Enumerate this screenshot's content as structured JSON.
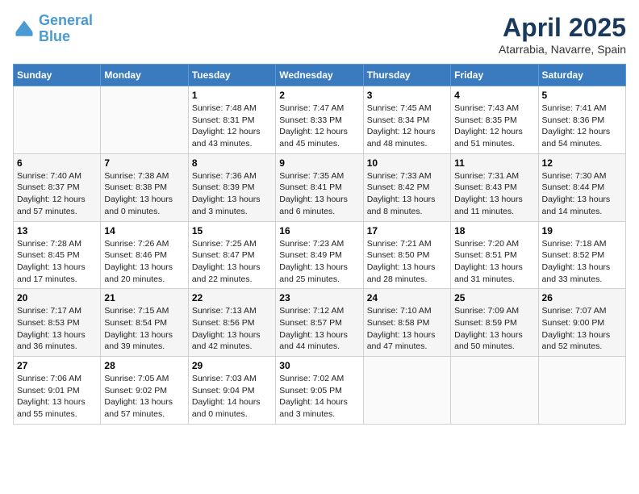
{
  "header": {
    "logo_general": "General",
    "logo_blue": "Blue",
    "month_title": "April 2025",
    "location": "Atarrabia, Navarre, Spain"
  },
  "weekdays": [
    "Sunday",
    "Monday",
    "Tuesday",
    "Wednesday",
    "Thursday",
    "Friday",
    "Saturday"
  ],
  "weeks": [
    [
      {
        "day": "",
        "sunrise": "",
        "sunset": "",
        "daylight": ""
      },
      {
        "day": "",
        "sunrise": "",
        "sunset": "",
        "daylight": ""
      },
      {
        "day": "1",
        "sunrise": "Sunrise: 7:48 AM",
        "sunset": "Sunset: 8:31 PM",
        "daylight": "Daylight: 12 hours and 43 minutes."
      },
      {
        "day": "2",
        "sunrise": "Sunrise: 7:47 AM",
        "sunset": "Sunset: 8:33 PM",
        "daylight": "Daylight: 12 hours and 45 minutes."
      },
      {
        "day": "3",
        "sunrise": "Sunrise: 7:45 AM",
        "sunset": "Sunset: 8:34 PM",
        "daylight": "Daylight: 12 hours and 48 minutes."
      },
      {
        "day": "4",
        "sunrise": "Sunrise: 7:43 AM",
        "sunset": "Sunset: 8:35 PM",
        "daylight": "Daylight: 12 hours and 51 minutes."
      },
      {
        "day": "5",
        "sunrise": "Sunrise: 7:41 AM",
        "sunset": "Sunset: 8:36 PM",
        "daylight": "Daylight: 12 hours and 54 minutes."
      }
    ],
    [
      {
        "day": "6",
        "sunrise": "Sunrise: 7:40 AM",
        "sunset": "Sunset: 8:37 PM",
        "daylight": "Daylight: 12 hours and 57 minutes."
      },
      {
        "day": "7",
        "sunrise": "Sunrise: 7:38 AM",
        "sunset": "Sunset: 8:38 PM",
        "daylight": "Daylight: 13 hours and 0 minutes."
      },
      {
        "day": "8",
        "sunrise": "Sunrise: 7:36 AM",
        "sunset": "Sunset: 8:39 PM",
        "daylight": "Daylight: 13 hours and 3 minutes."
      },
      {
        "day": "9",
        "sunrise": "Sunrise: 7:35 AM",
        "sunset": "Sunset: 8:41 PM",
        "daylight": "Daylight: 13 hours and 6 minutes."
      },
      {
        "day": "10",
        "sunrise": "Sunrise: 7:33 AM",
        "sunset": "Sunset: 8:42 PM",
        "daylight": "Daylight: 13 hours and 8 minutes."
      },
      {
        "day": "11",
        "sunrise": "Sunrise: 7:31 AM",
        "sunset": "Sunset: 8:43 PM",
        "daylight": "Daylight: 13 hours and 11 minutes."
      },
      {
        "day": "12",
        "sunrise": "Sunrise: 7:30 AM",
        "sunset": "Sunset: 8:44 PM",
        "daylight": "Daylight: 13 hours and 14 minutes."
      }
    ],
    [
      {
        "day": "13",
        "sunrise": "Sunrise: 7:28 AM",
        "sunset": "Sunset: 8:45 PM",
        "daylight": "Daylight: 13 hours and 17 minutes."
      },
      {
        "day": "14",
        "sunrise": "Sunrise: 7:26 AM",
        "sunset": "Sunset: 8:46 PM",
        "daylight": "Daylight: 13 hours and 20 minutes."
      },
      {
        "day": "15",
        "sunrise": "Sunrise: 7:25 AM",
        "sunset": "Sunset: 8:47 PM",
        "daylight": "Daylight: 13 hours and 22 minutes."
      },
      {
        "day": "16",
        "sunrise": "Sunrise: 7:23 AM",
        "sunset": "Sunset: 8:49 PM",
        "daylight": "Daylight: 13 hours and 25 minutes."
      },
      {
        "day": "17",
        "sunrise": "Sunrise: 7:21 AM",
        "sunset": "Sunset: 8:50 PM",
        "daylight": "Daylight: 13 hours and 28 minutes."
      },
      {
        "day": "18",
        "sunrise": "Sunrise: 7:20 AM",
        "sunset": "Sunset: 8:51 PM",
        "daylight": "Daylight: 13 hours and 31 minutes."
      },
      {
        "day": "19",
        "sunrise": "Sunrise: 7:18 AM",
        "sunset": "Sunset: 8:52 PM",
        "daylight": "Daylight: 13 hours and 33 minutes."
      }
    ],
    [
      {
        "day": "20",
        "sunrise": "Sunrise: 7:17 AM",
        "sunset": "Sunset: 8:53 PM",
        "daylight": "Daylight: 13 hours and 36 minutes."
      },
      {
        "day": "21",
        "sunrise": "Sunrise: 7:15 AM",
        "sunset": "Sunset: 8:54 PM",
        "daylight": "Daylight: 13 hours and 39 minutes."
      },
      {
        "day": "22",
        "sunrise": "Sunrise: 7:13 AM",
        "sunset": "Sunset: 8:56 PM",
        "daylight": "Daylight: 13 hours and 42 minutes."
      },
      {
        "day": "23",
        "sunrise": "Sunrise: 7:12 AM",
        "sunset": "Sunset: 8:57 PM",
        "daylight": "Daylight: 13 hours and 44 minutes."
      },
      {
        "day": "24",
        "sunrise": "Sunrise: 7:10 AM",
        "sunset": "Sunset: 8:58 PM",
        "daylight": "Daylight: 13 hours and 47 minutes."
      },
      {
        "day": "25",
        "sunrise": "Sunrise: 7:09 AM",
        "sunset": "Sunset: 8:59 PM",
        "daylight": "Daylight: 13 hours and 50 minutes."
      },
      {
        "day": "26",
        "sunrise": "Sunrise: 7:07 AM",
        "sunset": "Sunset: 9:00 PM",
        "daylight": "Daylight: 13 hours and 52 minutes."
      }
    ],
    [
      {
        "day": "27",
        "sunrise": "Sunrise: 7:06 AM",
        "sunset": "Sunset: 9:01 PM",
        "daylight": "Daylight: 13 hours and 55 minutes."
      },
      {
        "day": "28",
        "sunrise": "Sunrise: 7:05 AM",
        "sunset": "Sunset: 9:02 PM",
        "daylight": "Daylight: 13 hours and 57 minutes."
      },
      {
        "day": "29",
        "sunrise": "Sunrise: 7:03 AM",
        "sunset": "Sunset: 9:04 PM",
        "daylight": "Daylight: 14 hours and 0 minutes."
      },
      {
        "day": "30",
        "sunrise": "Sunrise: 7:02 AM",
        "sunset": "Sunset: 9:05 PM",
        "daylight": "Daylight: 14 hours and 3 minutes."
      },
      {
        "day": "",
        "sunrise": "",
        "sunset": "",
        "daylight": ""
      },
      {
        "day": "",
        "sunrise": "",
        "sunset": "",
        "daylight": ""
      },
      {
        "day": "",
        "sunrise": "",
        "sunset": "",
        "daylight": ""
      }
    ]
  ]
}
